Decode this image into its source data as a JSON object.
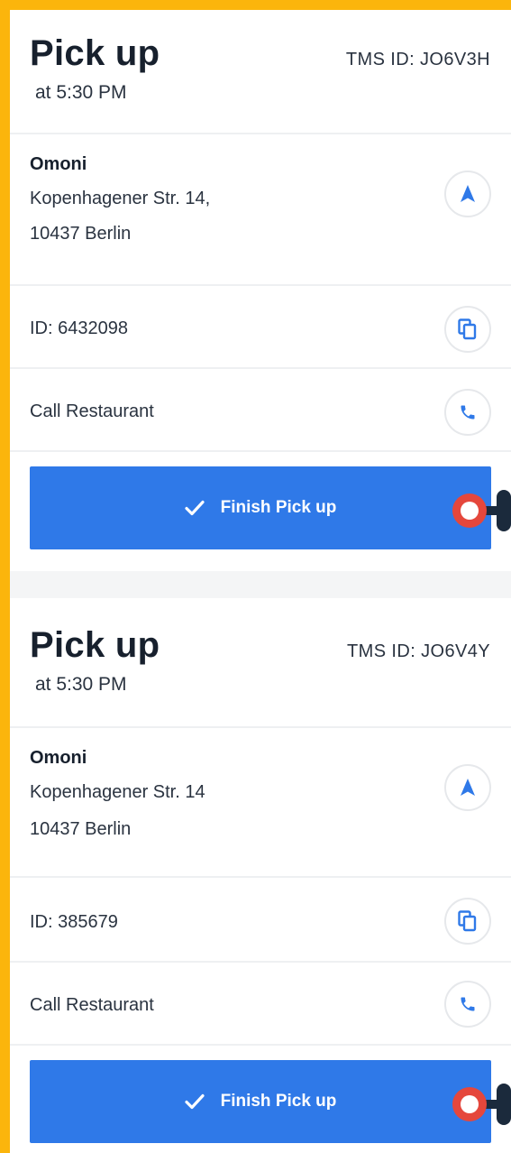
{
  "colors": {
    "frame": "#fbb50c",
    "accent": "#2f79e8",
    "title": "#17202d",
    "marker_ring": "#e5473c",
    "marker_dark": "#1b2a3c"
  },
  "cards": [
    {
      "title": "Pick up",
      "time": "at 5:30 PM",
      "tms_id": "TMS ID: JO6V3H",
      "restaurant": "Omoni",
      "address_line1": "Kopenhagener Str. 14,",
      "address_line2": "10437 Berlin",
      "order_id": "ID: 6432098",
      "call_label": "Call Restaurant",
      "finish_label": "Finish Pick up",
      "icons": [
        "navigate-icon",
        "copy-icon",
        "phone-icon",
        "checkmark-icon"
      ]
    },
    {
      "title": "Pick up",
      "time": "at 5:30 PM",
      "tms_id": "TMS ID: JO6V4Y",
      "restaurant": "Omoni",
      "address_line1": "Kopenhagener Str. 14",
      "address_line2": "10437 Berlin",
      "order_id": "ID: 385679",
      "call_label": "Call Restaurant",
      "finish_label": "Finish Pick up",
      "icons": [
        "navigate-icon",
        "copy-icon",
        "phone-icon",
        "checkmark-icon"
      ]
    }
  ]
}
